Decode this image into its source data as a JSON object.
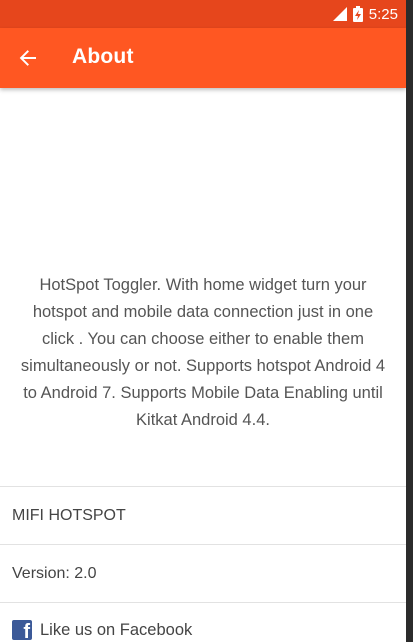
{
  "status_bar": {
    "time": "5:25",
    "icons": [
      "signal-icon",
      "battery-charging-icon"
    ]
  },
  "app_bar": {
    "title": "About",
    "back_icon": "arrow-back-icon"
  },
  "description": "HotSpot Toggler. With home widget turn your hotspot and mobile data connection just in one click . You can choose either to enable them simultaneously or not. Supports hotspot Android 4 to Android 7. Supports Mobile Data Enabling until Kitkat Android 4.4.",
  "info_rows": {
    "app_name": "MIFI HOTSPOT",
    "version": "Version: 2.0"
  },
  "facebook": {
    "label": "Like us on Facebook",
    "icon": "facebook-icon"
  },
  "colors": {
    "status_bar": "#e6461c",
    "app_bar": "#ff5722",
    "facebook_blue": "#3b5998"
  }
}
